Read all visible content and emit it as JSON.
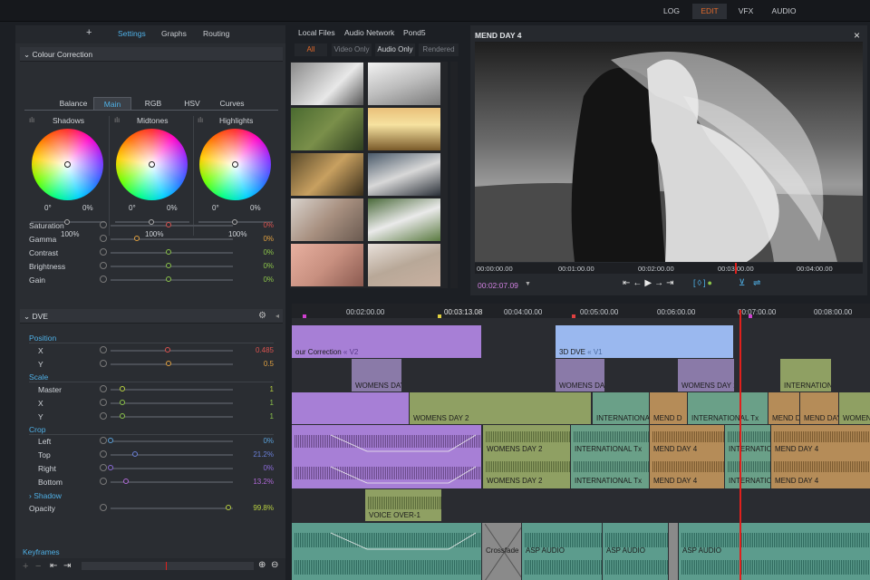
{
  "topnav": {
    "items": [
      "LOG",
      "EDIT",
      "VFX",
      "AUDIO"
    ],
    "active": "EDIT"
  },
  "leftpanel": {
    "tabs": {
      "add": "+",
      "settings": "Settings",
      "graphs": "Graphs",
      "routing": "Routing"
    },
    "colour": {
      "title": "Colour Correction",
      "subtabs": [
        "Balance",
        "Main",
        "RGB",
        "HSV",
        "Curves"
      ],
      "wheels": [
        {
          "label": "Shadows",
          "a": "0°",
          "b": "0%",
          "c": "100%"
        },
        {
          "label": "Midtones",
          "a": "0°",
          "b": "0%",
          "c": "100%"
        },
        {
          "label": "Highlights",
          "a": "0°",
          "b": "0%",
          "c": "100%"
        }
      ],
      "rows": [
        {
          "label": "Saturation",
          "value": "0%",
          "color": "#d9534f"
        },
        {
          "label": "Gamma",
          "value": "0%",
          "color": "#e0a040"
        },
        {
          "label": "Contrast",
          "value": "0%",
          "color": "#8bc34a"
        },
        {
          "label": "Brightness",
          "value": "0%",
          "color": "#8bc34a"
        },
        {
          "label": "Gain",
          "value": "0%",
          "color": "#8bc34a"
        }
      ]
    },
    "dve": {
      "title": "DVE",
      "position": "Position",
      "x": {
        "label": "X",
        "value": "0.485"
      },
      "y": {
        "label": "Y",
        "value": "0.5"
      },
      "scale": "Scale",
      "master": {
        "label": "Master",
        "value": "1"
      },
      "sx": {
        "label": "X",
        "value": "1"
      },
      "sy": {
        "label": "Y",
        "value": "1"
      },
      "crop": "Crop",
      "left": {
        "label": "Left",
        "value": "0%"
      },
      "top": {
        "label": "Top",
        "value": "21.2%"
      },
      "right": {
        "label": "Right",
        "value": "0%"
      },
      "bottom": {
        "label": "Bottom",
        "value": "13.2%"
      },
      "shadow": "Shadow",
      "opacity": {
        "label": "Opacity",
        "value": "99.8%"
      }
    },
    "keyframes": "Keyframes"
  },
  "media": {
    "tabs": [
      "Local Files",
      "Audio Network",
      "Pond5"
    ],
    "filters": [
      "All",
      "Video Only",
      "Audio Only",
      "Rendered"
    ]
  },
  "viewer": {
    "title": "MEND DAY 4",
    "close": "×",
    "ruler": [
      "00:00:00.00",
      "00:01:00.00",
      "00:02:00.00",
      "00:03:00.00",
      "00:04:00.00"
    ],
    "timecode": "00:02:07.09"
  },
  "timeline": {
    "ticks": [
      "00:02:00.00",
      "00:03:13.08",
      "00:04:00.00",
      "00:05:00.00",
      "00:06:00.00",
      "00:07:00.00",
      "00:08:00.00"
    ],
    "clips": {
      "cc": "our Correction",
      "cc_v": "« V2",
      "dve3d": "3D DVE",
      "dve3d_v": "« V1",
      "womens": "WOMENS DAY",
      "womens1": "WOMENS DAY 1",
      "intl": "INTERNATION",
      "womens2": "WOMENS DAY 2",
      "international": "INTERNATIONAL",
      "mendd": "MEND D",
      "intltx": "INTERNATIONAL Tx",
      "mend": "MEND DAY",
      "mend4": "MEND DAY 4",
      "wom": "WOMEN",
      "voice": "VOICE OVER-1",
      "crossfade": "Crossfade",
      "asp": "ASP AUDIO"
    }
  },
  "colors": {
    "accent": "#4fb0e6",
    "edit": "#e36a2a",
    "purple": "#a77fd6",
    "blue": "#7fa9e6",
    "olive": "#8fa063",
    "teal": "#5c9c8d",
    "tan": "#b58c58",
    "playhead": "#e0201c"
  }
}
